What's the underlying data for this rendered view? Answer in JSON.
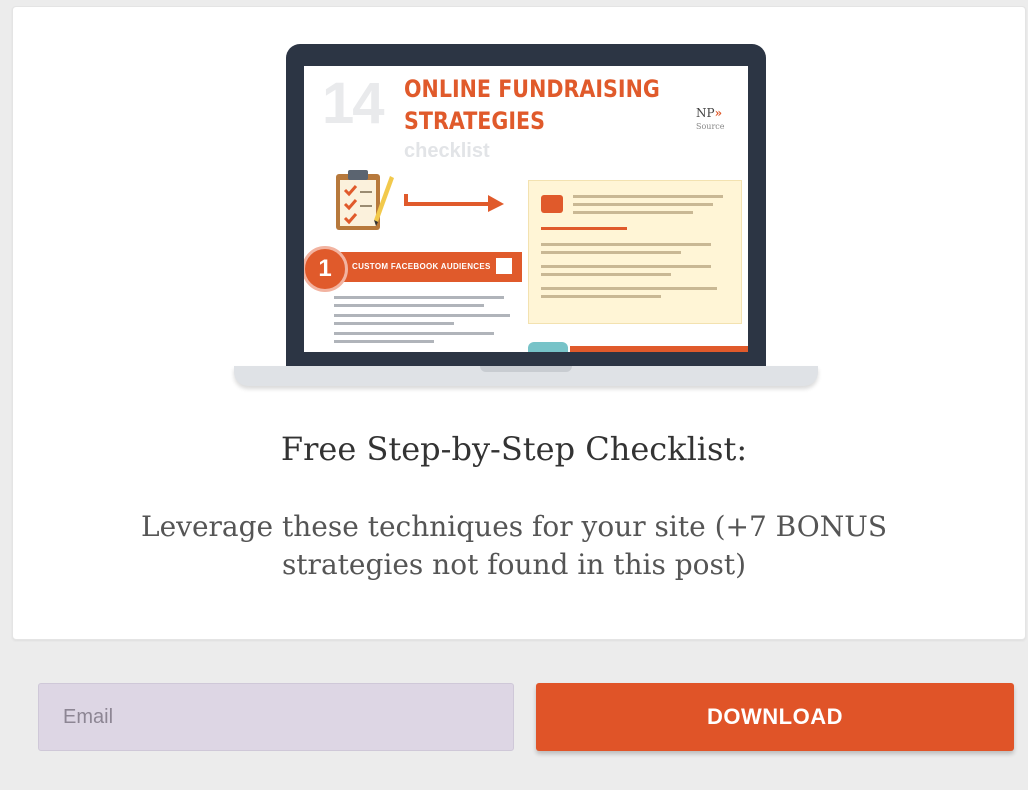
{
  "hero": {
    "screen": {
      "number": "14",
      "title_line1": "ONLINE FUNDRAISING",
      "title_line2": "STRATEGIES",
      "subtitle": "checklist",
      "brand": "NP",
      "brand_sub": "Source",
      "step_number": "1",
      "step_label": "CUSTOM FACEBOOK AUDIENCES"
    }
  },
  "content": {
    "headline": "Free Step-by-Step Checklist:",
    "subline": "Leverage these techniques for your site (+7 BONUS strategies not found in this post)"
  },
  "form": {
    "email_placeholder": "Email",
    "email_value": "",
    "download_label": "DOWNLOAD"
  },
  "colors": {
    "accent": "#e05428",
    "input_bg": "#ddd6e4",
    "page_bg": "#ececec"
  },
  "icons": [
    "clipboard-icon",
    "arrow-right-icon",
    "chat-icon",
    "checkbox-icon"
  ]
}
